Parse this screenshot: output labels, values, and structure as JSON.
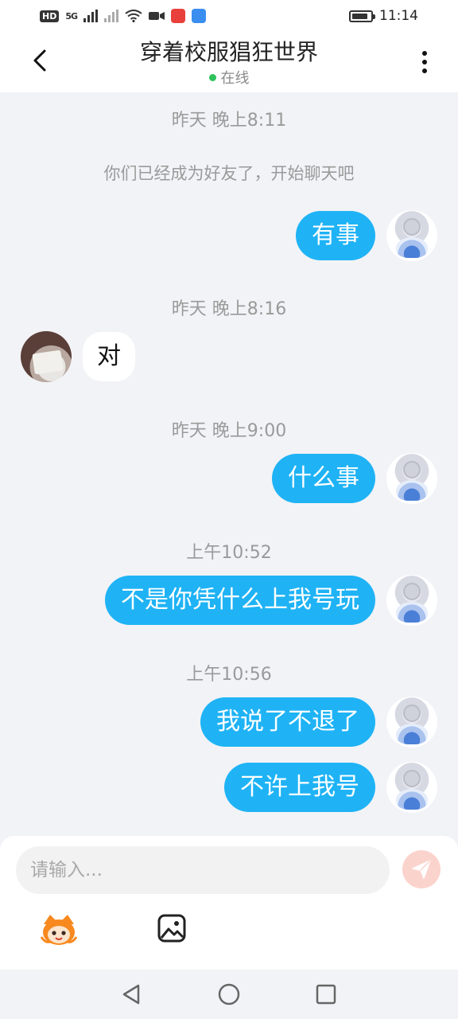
{
  "status_bar": {
    "network": "HD",
    "signal": "5G",
    "time": "11:14",
    "battery_level": 0.85
  },
  "header": {
    "title": "穿着校服猖狂世界",
    "status": "在线"
  },
  "chat": {
    "system_message": "你们已经成为好友了，开始聊天吧",
    "timestamps": [
      "昨天 晚上8:11",
      "昨天 晚上8:16",
      "昨天 晚上9:00",
      "上午10:52",
      "上午10:56"
    ],
    "messages": [
      {
        "sender": "me",
        "text": "有事"
      },
      {
        "sender": "peer",
        "text": "对"
      },
      {
        "sender": "me",
        "text": "什么事"
      },
      {
        "sender": "me",
        "text": "不是你凭什么上我号玩"
      },
      {
        "sender": "me",
        "text": "我说了不退了"
      },
      {
        "sender": "me",
        "text": "不许上我号"
      }
    ]
  },
  "composer": {
    "placeholder": "请输入..."
  },
  "colors": {
    "accent": "#1fb3f5",
    "online": "#2fc15b",
    "send": "#f7756a"
  },
  "icons": [
    "back-arrow-icon",
    "more-vertical-icon",
    "send-icon",
    "emoji-mascot-icon",
    "image-icon",
    "nav-back-icon",
    "nav-home-icon",
    "nav-recents-icon"
  ]
}
